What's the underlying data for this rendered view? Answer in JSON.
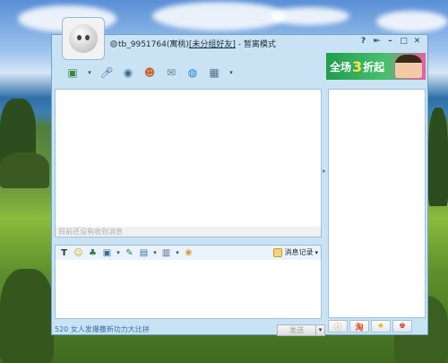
{
  "window": {
    "contact_id": "tb_9951764",
    "contact_nick": "(寓桃)",
    "group": "[未分组好友]",
    "separator": "-",
    "status": "暂离模式"
  },
  "toolbar": {
    "icons": [
      "transfer-file-icon",
      "voice-icon",
      "video-icon",
      "group-chat-icon",
      "mail-icon",
      "web-icon",
      "app-icon"
    ]
  },
  "ad": {
    "text_prefix": "全场",
    "text_number": "3",
    "text_suffix": "折起"
  },
  "chat": {
    "hint": "目前还没有收到消息"
  },
  "input_toolbar": {
    "history_label": "消息记录"
  },
  "footer": {
    "promo_text": "520 女人发爆撒新功力大比拼",
    "send_label": "发送"
  },
  "colors": {
    "window_bg": "#c9e3f5",
    "border": "#6fa3cf",
    "ad_green": "#1f9e4f"
  }
}
